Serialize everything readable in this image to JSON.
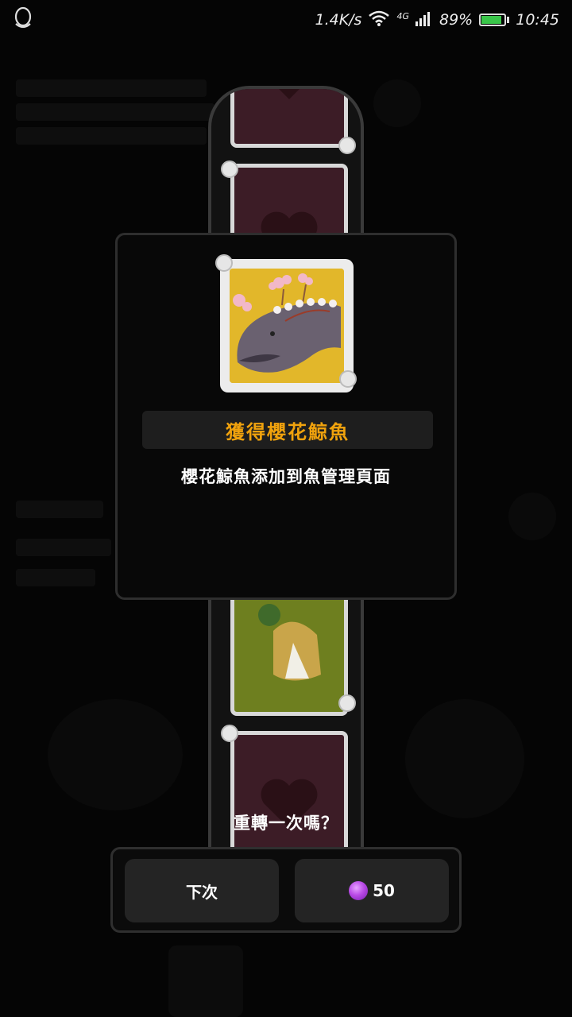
{
  "status_bar": {
    "network_speed": "1.4K/s",
    "network_type": "4G",
    "battery_percent": "89%",
    "battery_level": 0.89,
    "time": "10:45",
    "icons": [
      "qq-penguin-icon",
      "wifi-icon",
      "signal-icon",
      "battery-icon"
    ]
  },
  "reward_dialog": {
    "title": "獲得櫻花鯨魚",
    "description": "櫻花鯨魚添加到魚管理頁面",
    "item_icon": "sakura-whale-icon"
  },
  "respin": {
    "question": "重轉一次嗎？",
    "next_label": "下次",
    "cost": "50",
    "cost_icon": "purple-gem-icon"
  },
  "colors": {
    "title_accent": "#f0a20d",
    "card_bg_red": "#3c1c26",
    "card_bg_yellow": "#e2b72a",
    "card_bg_green": "#6e7f1f",
    "button_bg": "#242424"
  }
}
